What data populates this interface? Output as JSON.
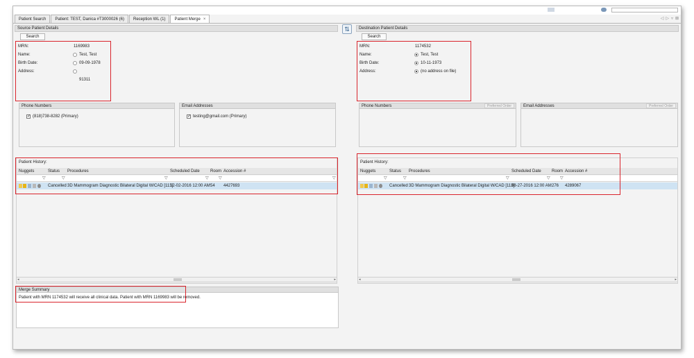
{
  "tabs": [
    {
      "label": "Patient Search"
    },
    {
      "label": "Patient: TEST, Danica #T3000026 (6)"
    },
    {
      "label": "Reception WL (1)"
    },
    {
      "label": "Patient Merge",
      "close": "×",
      "active": true
    }
  ],
  "icons": {
    "tab_close": "close-icon",
    "swap": "swap-icon",
    "filter": "filter-icon"
  },
  "source": {
    "header": "Source Patient Details",
    "search_label": "Search",
    "labels": {
      "mrn": "MRN:",
      "name": "Name:",
      "birth_date": "Birth Date:",
      "address": "Address:"
    },
    "mrn": "1169983",
    "name": "Test, Test",
    "birth_date": "09-09-1978",
    "address_line": "91311",
    "phone_header": "Phone Numbers",
    "phone": "(818)738-8282  (Primary)",
    "email_header": "Email Addresses",
    "email": "testing@gmail.com  (Primary)",
    "history_label": "Patient History:",
    "columns": {
      "nuggets": "Nuggets",
      "status": "Status",
      "procedures": "Procedures",
      "scheduled": "Scheduled Date",
      "room": "Room",
      "accession": "Accession #"
    },
    "row": {
      "status": "Cancelled",
      "procedure": "3D Mammogram Diagnostic Bilateral Digital W/CAD [113]",
      "scheduled": "12-02-2016 12:00 AM",
      "room": "54",
      "accession": "4427693"
    }
  },
  "destination": {
    "header": "Destination Patient Details",
    "search_label": "Search",
    "labels": {
      "mrn": "MRN:",
      "name": "Name:",
      "birth_date": "Birth Date:",
      "address": "Address:"
    },
    "mrn": "1174532",
    "name": "Test, Test",
    "birth_date": "10-11-1973",
    "address": "(no address on file)",
    "phone_header": "Phone Numbers",
    "email_header": "Email Addresses",
    "preferred_order": "Preferred Order",
    "history_label": "Patient History:",
    "columns": {
      "nuggets": "Nuggets",
      "status": "Status",
      "procedures": "Procedures",
      "scheduled": "Scheduled Date",
      "room": "Room",
      "accession": "Accession #"
    },
    "row": {
      "status": "Cancelled",
      "procedure": "3D Mammogram Diagnostic Bilateral Digital W/CAD [113]",
      "scheduled": "08-27-2016 12:00 AM",
      "room": "276",
      "accession": "4289067"
    }
  },
  "merge": {
    "header": "Merge Summary",
    "text": "Patient with MRN 1174532 will receive all clinical data.  Patient with MRN 1169983 will be removed."
  },
  "colors": {
    "highlight_red": "#d9232b",
    "selected_row": "#cfe3f3",
    "panel_bg": "#f3f3f3"
  }
}
